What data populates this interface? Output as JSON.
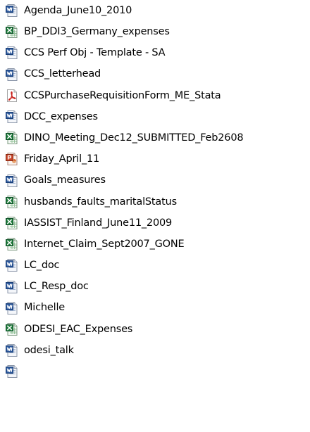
{
  "colors": {
    "word": "#2b579a",
    "excel": "#1d7a3a",
    "pdf": "#c8211b",
    "powerpoint": "#c8462a"
  },
  "files": [
    {
      "name": "Agenda_June10_2010",
      "icon": "word-doc-icon"
    },
    {
      "name": "BP_DDI3_Germany_expenses",
      "icon": "excel-sheet-icon"
    },
    {
      "name": "CCS Perf Obj - Template - SA",
      "icon": "word-doc-icon"
    },
    {
      "name": "CCS_letterhead",
      "icon": "word-doc-icon"
    },
    {
      "name": "CCSPurchaseRequisitionForm_ME_Stata",
      "icon": "pdf-file-icon"
    },
    {
      "name": "DCC_expenses",
      "icon": "word-doc-icon"
    },
    {
      "name": "DINO_Meeting_Dec12_SUBMITTED_Feb2608",
      "icon": "excel-sheet-icon"
    },
    {
      "name": "Friday_April_11",
      "icon": "powerpoint-icon"
    },
    {
      "name": "Goals_measures",
      "icon": "word-doc-icon"
    },
    {
      "name": "husbands_faults_maritalStatus",
      "icon": "excel-sheet-icon"
    },
    {
      "name": "IASSIST_Finland_June11_2009",
      "icon": "excel-sheet-icon"
    },
    {
      "name": "Internet_Claim_Sept2007_GONE",
      "icon": "excel-sheet-icon"
    },
    {
      "name": "LC_doc",
      "icon": "word-doc-icon"
    },
    {
      "name": "LC_Resp_doc",
      "icon": "word-doc-icon"
    },
    {
      "name": "Michelle",
      "icon": "word-doc-icon"
    },
    {
      "name": "ODESI_EAC_Expenses",
      "icon": "excel-sheet-icon"
    },
    {
      "name": "odesi_talk",
      "icon": "word-doc-icon"
    },
    {
      "name": "",
      "icon": "word-doc-icon"
    }
  ]
}
